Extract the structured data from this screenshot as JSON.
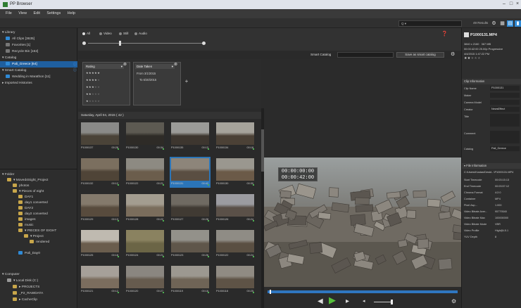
{
  "window": {
    "title": "PP Browser"
  },
  "menu": [
    "File",
    "View",
    "Edit",
    "Settings",
    "Help"
  ],
  "search": {
    "placeholder": "Q ▾"
  },
  "results_label": "49 Results",
  "sidebar": {
    "library_header": "▾ Library",
    "library_items": [
      "All Clips [3635]",
      "Favorites [1]",
      "Recycle Bin [162]"
    ],
    "catalog_header": "▾ Catalog",
    "catalog_items": [
      "Pali_Greece [64]"
    ],
    "smart_catalog_header": "▾ Smart Catalog",
    "smart_catalog_items": [
      "Wedding in Marathon [11]"
    ],
    "imported_header": "▸ Imported Histories",
    "folder_header": "▾ Folder",
    "folder_items": [
      "▾ Moved4Sight_Project",
      "photos",
      "▾ Pieces of eight",
      "DAY1",
      "day1 converted",
      "DAY2",
      "day2 converted",
      "images",
      "music",
      "▾ PIECES OF EIGHT",
      "▾ Project",
      "rendered",
      "Pali_Day0"
    ],
    "computer_header": "▾ Computer",
    "computer_items": [
      "▾ Local Disk (C:)",
      "▸ PROJECTS",
      "_P2_RAWDATA",
      "▸ CacheClip"
    ]
  },
  "filters": {
    "media_types": [
      "All",
      "Video",
      "Still",
      "Audio"
    ],
    "smart_catalog_label": "Smart Catalog",
    "save_button": "Save as smart catalog",
    "rating_label": "Rating",
    "rating_rows": [
      5,
      4,
      3,
      2,
      1
    ],
    "date_label": "Date Taken",
    "date_from": "From 3/1/2015",
    "date_to": "To 6/30/2015"
  },
  "grid": {
    "date_header": "Saturday, April 04, 2015 ( 42 )",
    "thumbnails": [
      {
        "name": "P1000137",
        "dur": "00:28"
      },
      {
        "name": "P1000130",
        "dur": "00:34"
      },
      {
        "name": "P1000135",
        "dur": "00:13"
      },
      {
        "name": "P1000134",
        "dur": "00:18"
      },
      {
        "name": "P1000132",
        "dur": "00:12"
      },
      {
        "name": "P1000122",
        "dur": "00:21"
      },
      {
        "name": "P1000131",
        "dur": "00:42"
      },
      {
        "name": "P1000130",
        "dur": "00:30"
      },
      {
        "name": "P1000129",
        "dur": "00:13"
      },
      {
        "name": "P1000128",
        "dur": "00:22"
      },
      {
        "name": "P1000127",
        "dur": "00:28"
      },
      {
        "name": "P1000126",
        "dur": "00:24"
      },
      {
        "name": "P1000125",
        "dur": "00:18"
      },
      {
        "name": "P1000124",
        "dur": "00:21"
      },
      {
        "name": "P1000123",
        "dur": "00:26"
      },
      {
        "name": "P1000122",
        "dur": "00:24"
      },
      {
        "name": "P1000121",
        "dur": "00:12"
      },
      {
        "name": "P1000120",
        "dur": "00:27"
      },
      {
        "name": "P1000119",
        "dur": "00:16"
      },
      {
        "name": "P1000118",
        "dur": "00:25"
      }
    ]
  },
  "viewer": {
    "timecode_line1": "00:00:00:00",
    "timecode_line2": "00:00:42:00",
    "progress": 0.01
  },
  "details": {
    "title": "P1000131.MP4",
    "res": "3840 x 2160",
    "size": "367 MB",
    "meta": "00:00:42:00  25.00p  Progressive",
    "date": "4/4/2015 1:47:22 PM",
    "rating_stars": 2,
    "clip_info_header": "Clip Information",
    "clip_fields": [
      {
        "label": "Clip Name",
        "value": "P1000131"
      },
      {
        "label": "Maker",
        "value": ""
      },
      {
        "label": "Camera Model",
        "value": ""
      },
      {
        "label": "Creator",
        "value": "NewsEffect"
      },
      {
        "label": "Title",
        "value": ""
      },
      {
        "label": "Comment",
        "value": ""
      },
      {
        "label": "Catalog",
        "value": "Pali_Greece"
      }
    ],
    "file_info_header": "▾ File Information",
    "file_path": "C:\\Users\\Kostas\\Deskt...\\P1000131.MP4",
    "file_fields": [
      {
        "label": "Start Timecode",
        "value": "00:03:15:13"
      },
      {
        "label": "End Timecode",
        "value": "00:03:57:12"
      },
      {
        "label": "Chroma Format",
        "value": "4:2:0"
      },
      {
        "label": "Container",
        "value": "MP4"
      },
      {
        "label": "Pixel Asp...",
        "value": "1.000"
      },
      {
        "label": "Video Bitrate Aver...",
        "value": "95779340"
      },
      {
        "label": "Video Bitrate Max",
        "value": "100000000"
      },
      {
        "label": "Video Bitrate Mode",
        "value": "VBR"
      },
      {
        "label": "Video Profile",
        "value": "High@L5.1"
      },
      {
        "label": "YUV Depth",
        "value": "8"
      }
    ]
  }
}
